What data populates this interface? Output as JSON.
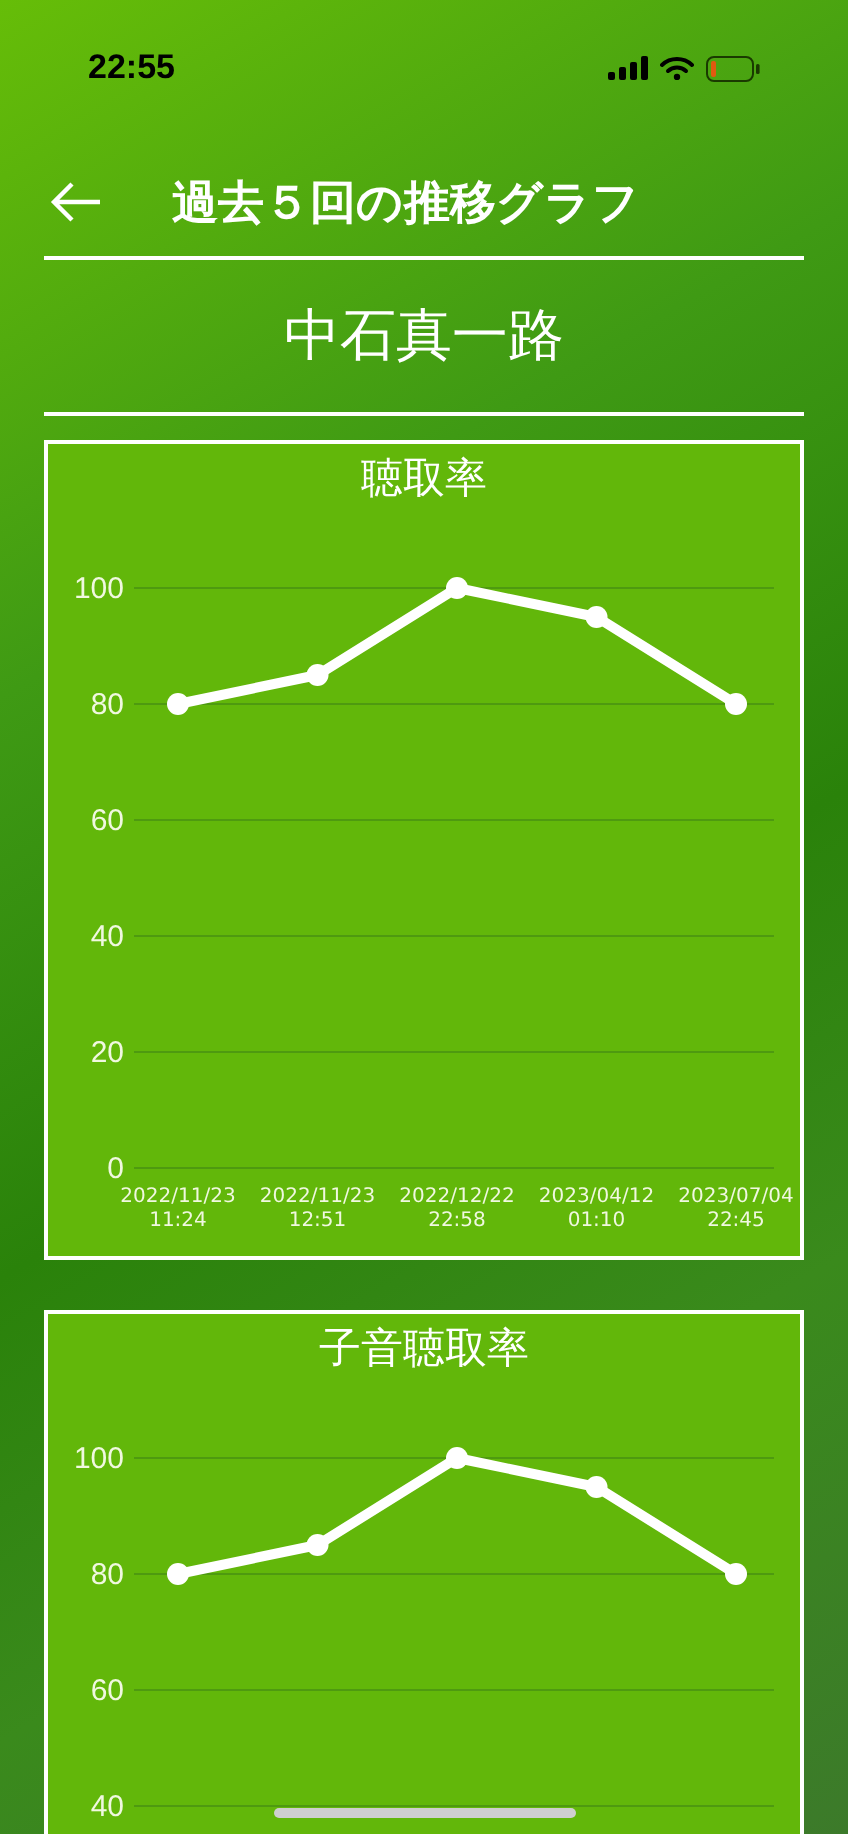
{
  "status_bar": {
    "time": "22:55"
  },
  "header": {
    "title": "過去５回の推移グラフ"
  },
  "person": {
    "name": "中石真一路"
  },
  "charts": [
    {
      "chart_data": {
        "type": "line",
        "title": "聴取率",
        "categories": [
          "2022/11/23 11:24",
          "2022/11/23 12:51",
          "2022/12/22 22:58",
          "2023/04/12 01:10",
          "2023/07/04 22:45"
        ],
        "series": [
          {
            "color": "#ffffff",
            "marker": true,
            "values": [
              80,
              85,
              100,
              95,
              80
            ]
          }
        ],
        "grid": true,
        "ylim": [
          0,
          100
        ],
        "yticks": [
          0,
          20,
          40,
          60,
          80,
          100
        ]
      }
    },
    {
      "chart_data": {
        "type": "line",
        "title": "子音聴取率",
        "series": [
          {
            "color": "#ffffff",
            "marker": true,
            "values": [
              80,
              85,
              100,
              95,
              80
            ]
          }
        ],
        "grid": true,
        "ylim": [
          40,
          100
        ],
        "yticks": [
          40,
          60,
          80,
          100
        ]
      }
    }
  ]
}
